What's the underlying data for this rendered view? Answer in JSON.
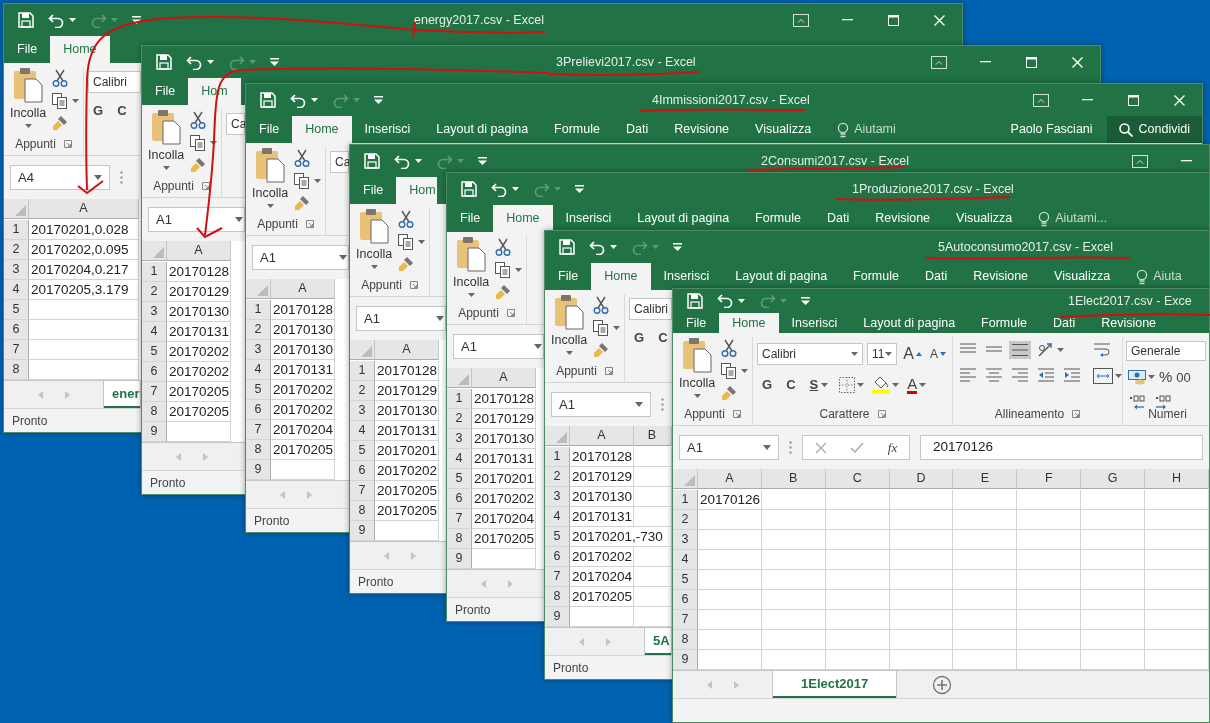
{
  "windows": [
    {
      "title": "energy2017.csv - Excel",
      "tabs": [
        {
          "label": "File",
          "selected": false,
          "kind": "tab"
        },
        {
          "label": "Home",
          "selected": true,
          "kind": "tab"
        }
      ],
      "clipboard": {
        "paste": "Incolla",
        "group": "Appunti"
      },
      "font": {
        "name": "Calibri",
        "styles": [
          "G",
          "C"
        ]
      },
      "name_box": "A4",
      "columns": [
        "A"
      ],
      "rows": [
        {
          "number": "1",
          "cells": [
            "20170201,0.028"
          ]
        },
        {
          "number": "2",
          "cells": [
            "20170202,0.095"
          ]
        },
        {
          "number": "3",
          "cells": [
            "20170204,0.217"
          ]
        },
        {
          "number": "4",
          "cells": [
            "20170205,3.179"
          ]
        },
        {
          "number": "5"
        },
        {
          "number": "6"
        },
        {
          "number": "7"
        },
        {
          "number": "8"
        }
      ],
      "sheet_tabs": [
        {
          "label": "ener",
          "selected": true
        }
      ],
      "status": "Pronto"
    },
    {
      "title": "3Prelievi2017.csv - Excel",
      "tabs": [
        {
          "label": "File",
          "selected": false,
          "kind": "tab"
        },
        {
          "label": "Hom",
          "selected": true,
          "kind": "tab"
        }
      ],
      "clipboard": {
        "paste": "Incolla",
        "group": "Appunti"
      },
      "font": {
        "name": "Ca"
      },
      "name_box": "A1",
      "columns": [
        "A"
      ],
      "rows": [
        {
          "number": "1",
          "cells": [
            "20170128"
          ]
        },
        {
          "number": "2",
          "cells": [
            "20170129"
          ]
        },
        {
          "number": "3",
          "cells": [
            "20170130"
          ]
        },
        {
          "number": "4",
          "cells": [
            "20170131"
          ]
        },
        {
          "number": "5",
          "cells": [
            "20170202"
          ]
        },
        {
          "number": "6",
          "cells": [
            "20170202"
          ]
        },
        {
          "number": "7",
          "cells": [
            "20170205"
          ]
        },
        {
          "number": "8",
          "cells": [
            "20170205"
          ]
        },
        {
          "number": "9"
        }
      ],
      "status": "Pronto"
    },
    {
      "title": "4Immissioni2017.csv - Excel",
      "tabs": [
        {
          "label": "File",
          "selected": false,
          "kind": "tab"
        },
        {
          "label": "Home",
          "selected": true,
          "kind": "tab"
        },
        {
          "label": "Inserisci",
          "selected": false,
          "kind": "tab"
        },
        {
          "label": "Layout di pagina",
          "selected": false,
          "kind": "tab"
        },
        {
          "label": "Formule",
          "selected": false,
          "kind": "tab"
        },
        {
          "label": "Dati",
          "selected": false,
          "kind": "tab"
        },
        {
          "label": "Revisione",
          "selected": false,
          "kind": "tab"
        },
        {
          "label": "Visualizza",
          "selected": false,
          "kind": "tab"
        },
        {
          "label": "Aiutami",
          "selected": false,
          "kind": "tell"
        }
      ],
      "account": {
        "user": "Paolo Fasciani",
        "share": "Condividi"
      },
      "clipboard": {
        "paste": "Incolla",
        "group": "Appunti"
      },
      "font": {
        "name": "Ca"
      },
      "name_box": "A1",
      "columns": [
        "A"
      ],
      "rows": [
        {
          "number": "1",
          "cells": [
            "20170128"
          ]
        },
        {
          "number": "2",
          "cells": [
            "20170130"
          ]
        },
        {
          "number": "3",
          "cells": [
            "20170130"
          ]
        },
        {
          "number": "4",
          "cells": [
            "20170131"
          ]
        },
        {
          "number": "5",
          "cells": [
            "20170202"
          ]
        },
        {
          "number": "6",
          "cells": [
            "20170202"
          ]
        },
        {
          "number": "7",
          "cells": [
            "20170204"
          ]
        },
        {
          "number": "8",
          "cells": [
            "20170205"
          ]
        },
        {
          "number": "9"
        }
      ],
      "status": "Pronto"
    },
    {
      "title": "2Consumi2017.csv - Excel",
      "tabs": [
        {
          "label": "File",
          "selected": false,
          "kind": "tab"
        },
        {
          "label": "Hom",
          "selected": true,
          "kind": "tab"
        }
      ],
      "clipboard": {
        "paste": "Incolla",
        "group": "Appunti"
      },
      "name_box": "A1",
      "columns": [
        "A"
      ],
      "rows": [
        {
          "number": "1",
          "cells": [
            "20170128"
          ]
        },
        {
          "number": "2",
          "cells": [
            "20170129"
          ]
        },
        {
          "number": "3",
          "cells": [
            "20170130"
          ]
        },
        {
          "number": "4",
          "cells": [
            "20170131"
          ]
        },
        {
          "number": "5",
          "cells": [
            "20170201"
          ]
        },
        {
          "number": "6",
          "cells": [
            "20170202"
          ]
        },
        {
          "number": "7",
          "cells": [
            "20170205"
          ]
        },
        {
          "number": "8",
          "cells": [
            "20170205"
          ]
        },
        {
          "number": "9"
        }
      ],
      "status": "Pronto"
    },
    {
      "title": "1Produzione2017.csv - Excel",
      "tabs": [
        {
          "label": "File",
          "selected": false,
          "kind": "tab"
        },
        {
          "label": "Home",
          "selected": true,
          "kind": "tab"
        },
        {
          "label": "Inserisci",
          "selected": false,
          "kind": "tab"
        },
        {
          "label": "Layout di pagina",
          "selected": false,
          "kind": "tab"
        },
        {
          "label": "Formule",
          "selected": false,
          "kind": "tab"
        },
        {
          "label": "Dati",
          "selected": false,
          "kind": "tab"
        },
        {
          "label": "Revisione",
          "selected": false,
          "kind": "tab"
        },
        {
          "label": "Visualizza",
          "selected": false,
          "kind": "tab"
        },
        {
          "label": "Aiutami...",
          "selected": false,
          "kind": "tell"
        }
      ],
      "clipboard": {
        "paste": "Incolla",
        "group": "Appunti"
      },
      "name_box": "A1",
      "columns": [
        "A"
      ],
      "rows": [
        {
          "number": "1",
          "cells": [
            "20170128"
          ]
        },
        {
          "number": "2",
          "cells": [
            "20170129"
          ]
        },
        {
          "number": "3",
          "cells": [
            "20170130"
          ]
        },
        {
          "number": "4",
          "cells": [
            "20170131"
          ]
        },
        {
          "number": "5",
          "cells": [
            "20170201"
          ]
        },
        {
          "number": "6",
          "cells": [
            "20170202"
          ]
        },
        {
          "number": "7",
          "cells": [
            "20170204"
          ]
        },
        {
          "number": "8",
          "cells": [
            "20170205"
          ]
        },
        {
          "number": "9"
        }
      ],
      "status": "Pronto"
    },
    {
      "title": "5Autoconsumo2017.csv - Excel",
      "tabs": [
        {
          "label": "File",
          "selected": false,
          "kind": "tab"
        },
        {
          "label": "Home",
          "selected": true,
          "kind": "tab"
        },
        {
          "label": "Inserisci",
          "selected": false,
          "kind": "tab"
        },
        {
          "label": "Layout di pagina",
          "selected": false,
          "kind": "tab"
        },
        {
          "label": "Formule",
          "selected": false,
          "kind": "tab"
        },
        {
          "label": "Dati",
          "selected": false,
          "kind": "tab"
        },
        {
          "label": "Revisione",
          "selected": false,
          "kind": "tab"
        },
        {
          "label": "Visualizza",
          "selected": false,
          "kind": "tab"
        },
        {
          "label": "Aiuta",
          "selected": false,
          "kind": "tell"
        }
      ],
      "clipboard": {
        "paste": "Incolla",
        "group": "Appunti"
      },
      "font": {
        "name": "Calibri",
        "styles": [
          "G",
          "C"
        ]
      },
      "name_box": "A1",
      "columns": [
        "A",
        "B"
      ],
      "rows": [
        {
          "number": "1",
          "cells": [
            "20170128"
          ]
        },
        {
          "number": "2",
          "cells": [
            "20170129"
          ]
        },
        {
          "number": "3",
          "cells": [
            "20170130"
          ]
        },
        {
          "number": "4",
          "cells": [
            "20170131"
          ]
        },
        {
          "number": "5",
          "cells": [
            "20170201,-730"
          ]
        },
        {
          "number": "6",
          "cells": [
            "20170202"
          ]
        },
        {
          "number": "7",
          "cells": [
            "20170204"
          ]
        },
        {
          "number": "8",
          "cells": [
            "20170205"
          ]
        },
        {
          "number": "9"
        }
      ],
      "sheet_tabs": [
        {
          "label": "5A",
          "selected": true
        }
      ],
      "status": "Pronto"
    },
    {
      "title": "1Elect2017.csv - Exce",
      "tabs": [
        {
          "label": "File",
          "selected": false,
          "kind": "tab"
        },
        {
          "label": "Home",
          "selected": true,
          "kind": "tab"
        },
        {
          "label": "Inserisci",
          "selected": false,
          "kind": "tab"
        },
        {
          "label": "Layout di pagina",
          "selected": false,
          "kind": "tab"
        },
        {
          "label": "Formule",
          "selected": false,
          "kind": "tab"
        },
        {
          "label": "Dati",
          "selected": false,
          "kind": "tab"
        },
        {
          "label": "Revisione",
          "selected": false,
          "kind": "tab"
        }
      ],
      "clipboard": {
        "paste": "Incolla",
        "group": "Appunti"
      },
      "font": {
        "name": "Calibri",
        "size": "11",
        "grow": "A",
        "shrink": "A",
        "styles": [
          "G",
          "C",
          "S"
        ],
        "color_letter": "A",
        "group": "Carattere"
      },
      "alignment": {
        "group": "Allineamento"
      },
      "number": {
        "format": "Generale",
        "percent": "%",
        "thousands": "00",
        "group": "Numeri"
      },
      "name_box": "A1",
      "formula": {
        "fx": "fx",
        "value": "20170126"
      },
      "columns": [
        "A",
        "B",
        "C",
        "D",
        "E",
        "F",
        "G",
        "H"
      ],
      "rows": [
        {
          "number": "1",
          "cells": [
            "20170126"
          ]
        },
        {
          "number": "2"
        },
        {
          "number": "3"
        },
        {
          "number": "4"
        },
        {
          "number": "5"
        },
        {
          "number": "6"
        },
        {
          "number": "7"
        },
        {
          "number": "8"
        },
        {
          "number": "9"
        }
      ],
      "sheet_tabs": [
        {
          "label": "1Elect2017",
          "selected": true
        }
      ],
      "add_sheet": true
    }
  ]
}
